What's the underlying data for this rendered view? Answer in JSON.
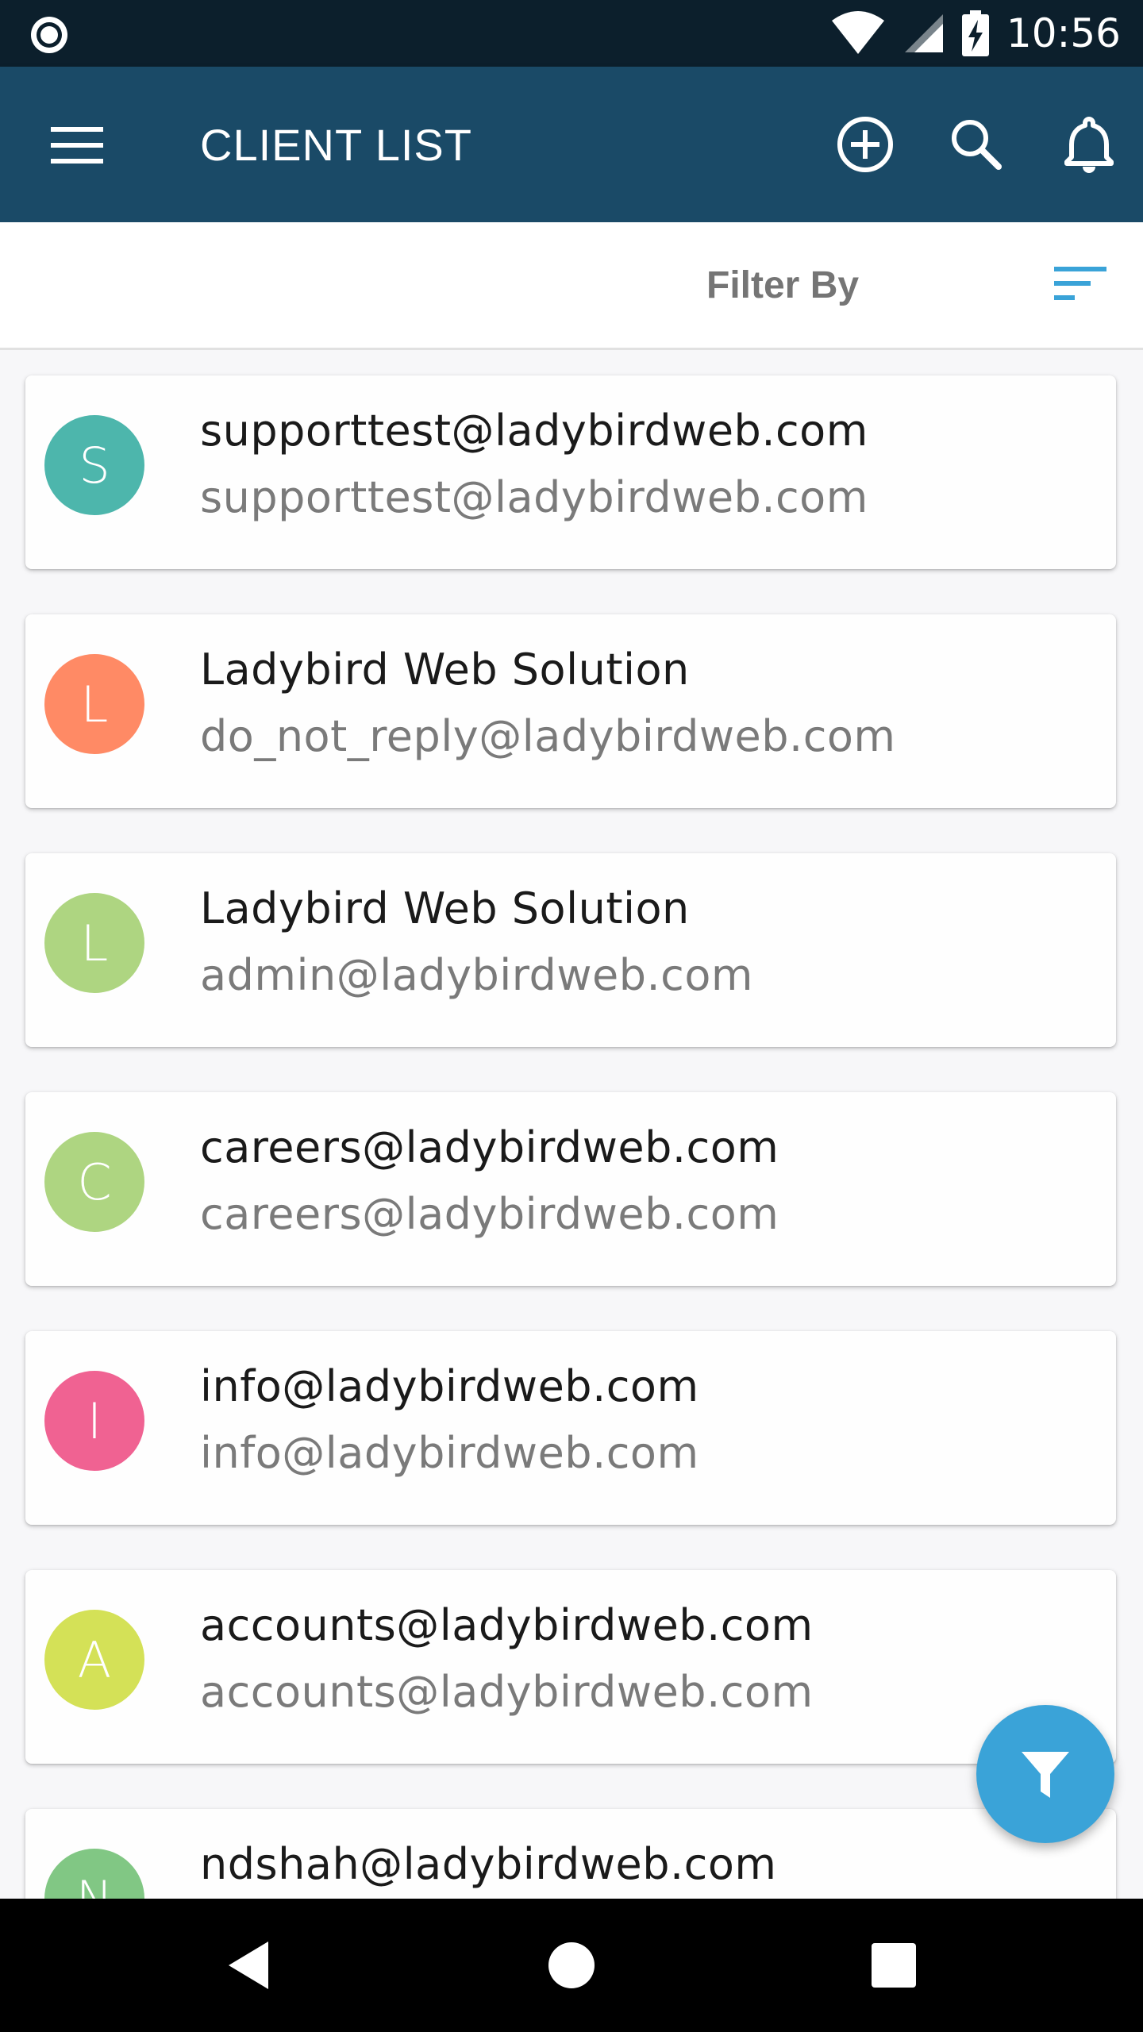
{
  "status_bar": {
    "time": "10:56",
    "icons": [
      "record-icon",
      "wifi-icon",
      "signal-icon",
      "battery-charging-icon"
    ]
  },
  "app_bar": {
    "title": "CLIENT LIST",
    "actions": [
      "menu-icon",
      "add-circle-icon",
      "search-icon",
      "bell-icon"
    ]
  },
  "filter": {
    "label": "Filter By",
    "icon": "sort-icon",
    "accent": "#3aa3d8"
  },
  "clients": [
    {
      "initial": "S",
      "name": "supporttest@ladybirdweb.com",
      "email": "supporttest@ladybirdweb.com",
      "color": "#4db6ac"
    },
    {
      "initial": "L",
      "name": "Ladybird Web Solution",
      "email": "do_not_reply@ladybirdweb.com",
      "color": "#ff8a65"
    },
    {
      "initial": "L",
      "name": "Ladybird Web Solution",
      "email": "admin@ladybirdweb.com",
      "color": "#aed581"
    },
    {
      "initial": "C",
      "name": "careers@ladybirdweb.com",
      "email": "careers@ladybirdweb.com",
      "color": "#aed581"
    },
    {
      "initial": "I",
      "name": "info@ladybirdweb.com",
      "email": "info@ladybirdweb.com",
      "color": "#f06292"
    },
    {
      "initial": "A",
      "name": "accounts@ladybirdweb.com",
      "email": "accounts@ladybirdweb.com",
      "color": "#d4e157"
    },
    {
      "initial": "N",
      "name": "ndshah@ladybirdweb.com",
      "email": "",
      "color": "#81c784"
    }
  ],
  "fab": {
    "icon": "filter-funnel-icon",
    "color": "#3aa3d8"
  },
  "nav_bar": {
    "icons": [
      "back-icon",
      "home-icon",
      "recents-icon"
    ]
  },
  "colors": {
    "app_bar": "#1a4a67",
    "status_bar": "#0c1f2c"
  }
}
